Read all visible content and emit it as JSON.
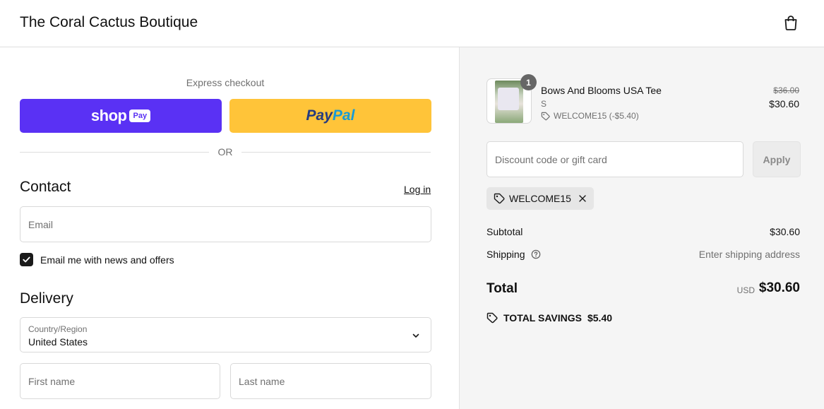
{
  "header": {
    "store_name": "The Coral Cactus Boutique",
    "cart_icon": "shopping-bag-icon"
  },
  "express": {
    "label": "Express checkout",
    "shop_pay": {
      "shop": "shop",
      "pay": "Pay",
      "color": "#5a31f4"
    },
    "paypal": {
      "pay": "Pay",
      "pal": "Pal",
      "color": "#ffc439"
    },
    "or_text": "OR"
  },
  "contact": {
    "title": "Contact",
    "login_link": "Log in",
    "email_placeholder": "Email",
    "newsletter_label": "Email me with news and offers",
    "newsletter_checked": true
  },
  "delivery": {
    "title": "Delivery",
    "country_label": "Country/Region",
    "country_value": "United States",
    "first_name_placeholder": "First name",
    "last_name_placeholder": "Last name"
  },
  "summary": {
    "item": {
      "name": "Bows And Blooms USA Tee",
      "variant": "S",
      "quantity": "1",
      "discount": "WELCOME15 (-$5.40)",
      "original_price": "$36.00",
      "price": "$30.60"
    },
    "discount_placeholder": "Discount code or gift card",
    "apply_label": "Apply",
    "applied_code": "WELCOME15",
    "subtotal_label": "Subtotal",
    "subtotal_value": "$30.60",
    "shipping_label": "Shipping",
    "shipping_value": "Enter shipping address",
    "total_label": "Total",
    "currency": "USD",
    "total_value": "$30.60",
    "savings_label": "TOTAL SAVINGS",
    "savings_value": "$5.40"
  }
}
